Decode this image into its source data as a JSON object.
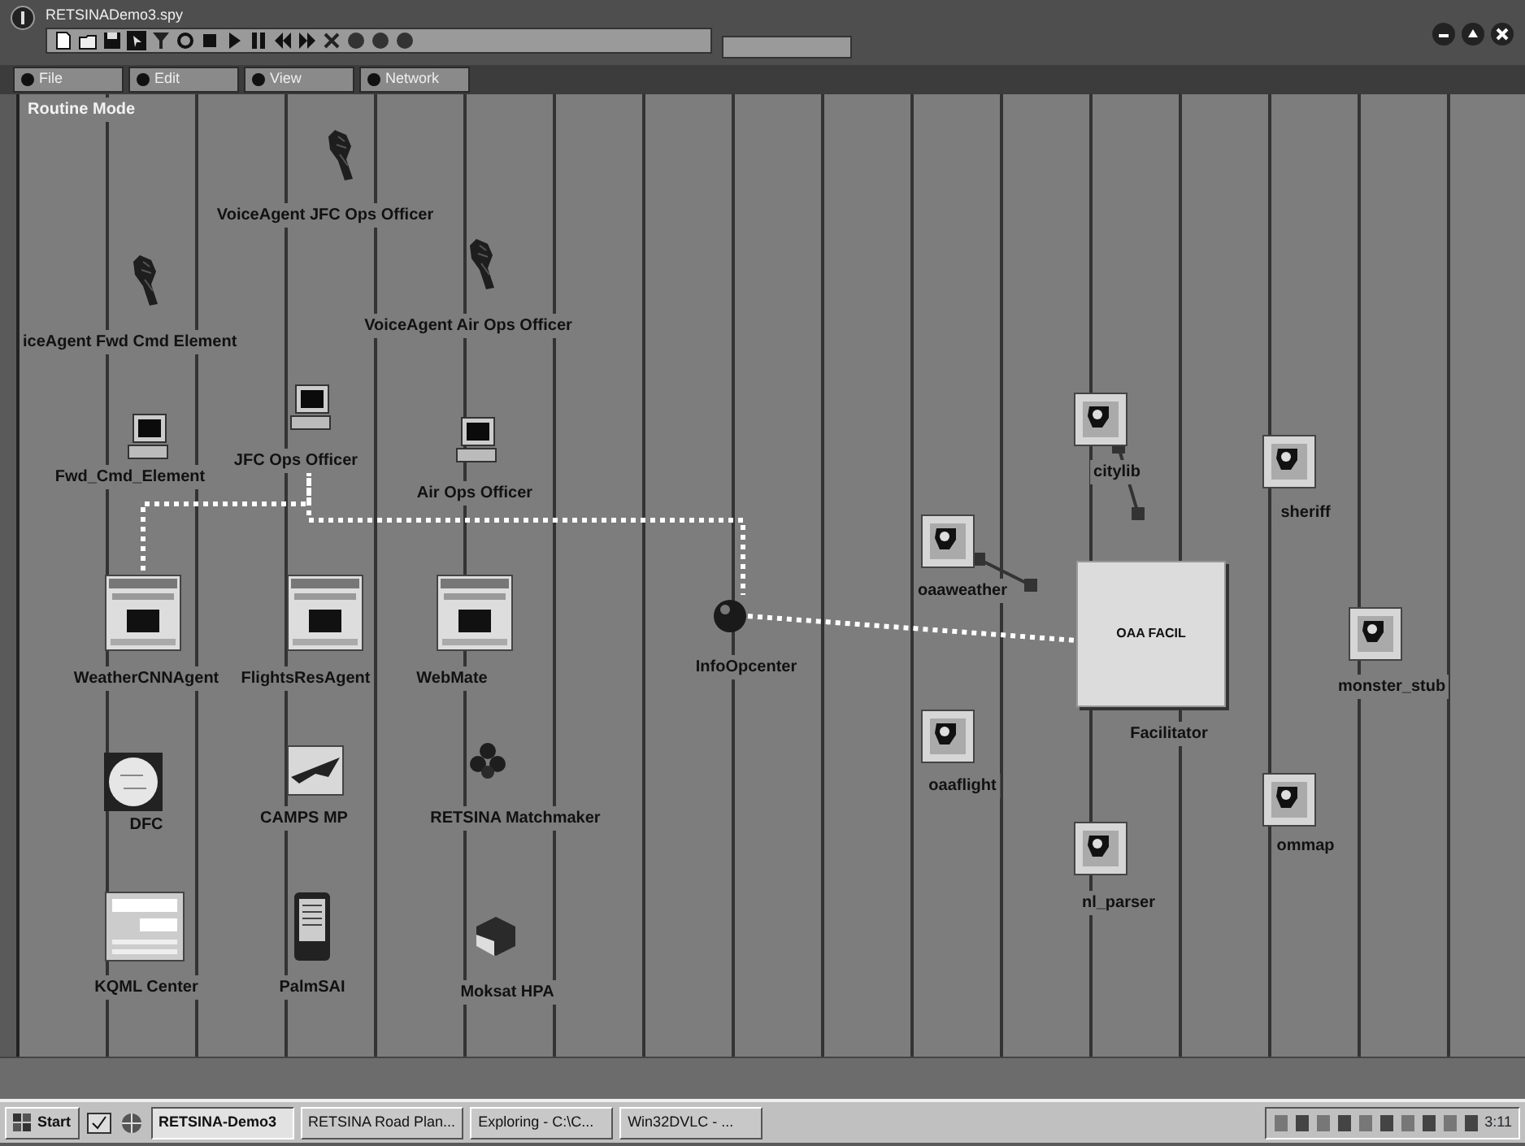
{
  "window": {
    "title": "RETSINADemo3.spy"
  },
  "menu": [
    {
      "label": "File"
    },
    {
      "label": "Edit"
    },
    {
      "label": "View"
    },
    {
      "label": "Network"
    }
  ],
  "mode_label": "Routine Mode",
  "nodes": [
    {
      "kind": "voice",
      "label": "VoiceAgent JFC Ops Officer"
    },
    {
      "kind": "voice",
      "label": "iceAgent Fwd Cmd Element"
    },
    {
      "kind": "voice",
      "label": "VoiceAgent Air Ops Officer"
    },
    {
      "kind": "computer",
      "label": "Fwd_Cmd_Element"
    },
    {
      "kind": "computer",
      "label": "JFC Ops Officer",
      "connector": {
        "kind": "dotted"
      }
    },
    {
      "kind": "computer",
      "label": "Air Ops Officer"
    },
    {
      "kind": "browser",
      "label": "WeatherCNNAgent",
      "connector": {
        "kind": "dotted"
      }
    },
    {
      "kind": "browser",
      "label": "FlightsResAgent"
    },
    {
      "kind": "browser",
      "label": "WebMate"
    },
    {
      "kind": "sphere",
      "label": "InfoOpcenter",
      "connector": {
        "kind": "dotted"
      }
    },
    {
      "kind": "globe",
      "label": "DFC"
    },
    {
      "kind": "plane",
      "label": "CAMPS MP"
    },
    {
      "kind": "flower",
      "label": "RETSINA Matchmaker"
    },
    {
      "kind": "form",
      "label": "KQML Center"
    },
    {
      "kind": "pda",
      "label": "PalmSAI"
    },
    {
      "kind": "cube",
      "label": "Moksat HPA"
    },
    {
      "kind": "tile",
      "label": "oaaweather",
      "connector": {
        "kind": "solid"
      }
    },
    {
      "kind": "tile",
      "label": "oaaflight"
    },
    {
      "kind": "tile",
      "label": "citylib",
      "connector": {
        "kind": "solid"
      }
    },
    {
      "kind": "facilitator",
      "label": "Facilitator",
      "caption": "OAA FACIL"
    },
    {
      "kind": "tile",
      "label": "sheriff"
    },
    {
      "kind": "tile",
      "label": "monster_stub"
    },
    {
      "kind": "tile",
      "label": "ommap"
    },
    {
      "kind": "tile",
      "label": "nl_parser"
    }
  ],
  "taskbar": {
    "start": "Start",
    "tasks": [
      {
        "label": "RETSINA-Demo3",
        "selected": true
      },
      {
        "label": "RETSINA Road Plan...",
        "selected": false
      },
      {
        "label": "Exploring - C:\\C...",
        "selected": false
      },
      {
        "label": "Win32DVLC - ...",
        "selected": false
      }
    ],
    "clock": "3:11"
  }
}
